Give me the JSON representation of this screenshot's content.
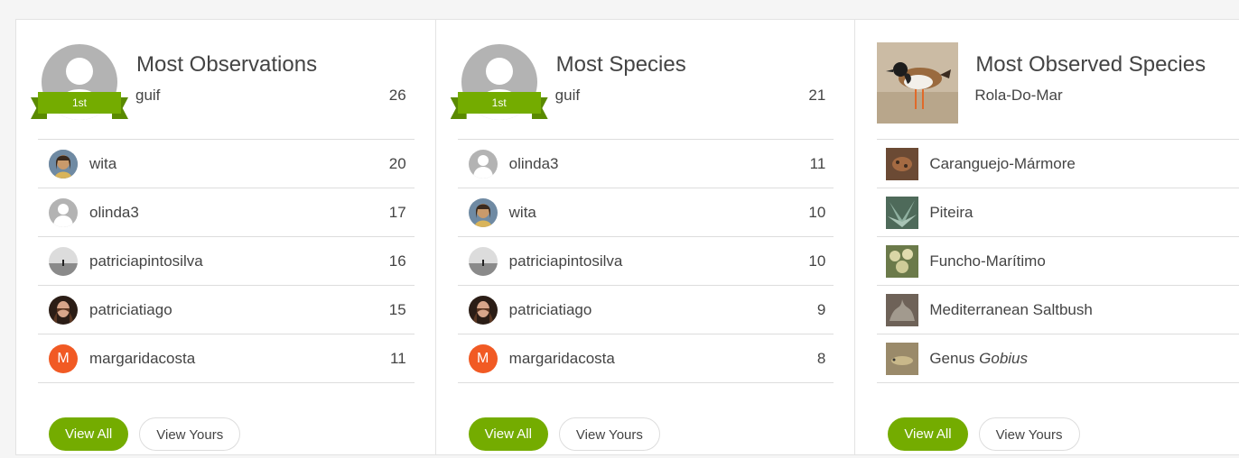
{
  "observers": {
    "title": "Most Observations",
    "rank_label": "1st",
    "leader": {
      "name": "guif",
      "count": "26"
    },
    "rows": [
      {
        "name": "wita",
        "count": "20"
      },
      {
        "name": "olinda3",
        "count": "17"
      },
      {
        "name": "patriciapintosilva",
        "count": "16"
      },
      {
        "name": "patriciatiago",
        "count": "15"
      },
      {
        "name": "margaridacosta",
        "count": "11",
        "initial": "M"
      }
    ],
    "view_all": "View All",
    "view_yours": "View Yours"
  },
  "species_observers": {
    "title": "Most Species",
    "rank_label": "1st",
    "leader": {
      "name": "guif",
      "count": "21"
    },
    "rows": [
      {
        "name": "olinda3",
        "count": "11"
      },
      {
        "name": "wita",
        "count": "10"
      },
      {
        "name": "patriciapintosilva",
        "count": "10"
      },
      {
        "name": "patriciatiago",
        "count": "9"
      },
      {
        "name": "margaridacosta",
        "count": "8",
        "initial": "M"
      }
    ],
    "view_all": "View All",
    "view_yours": "View Yours"
  },
  "species": {
    "title": "Most Observed Species",
    "leader": {
      "name": "Rola-Do-Mar"
    },
    "rows": [
      {
        "name": "Caranguejo-Mármore"
      },
      {
        "name": "Piteira"
      },
      {
        "name": "Funcho-Marítimo"
      },
      {
        "name": "Mediterranean Saltbush"
      },
      {
        "rank": "Genus",
        "name": "Gobius"
      }
    ],
    "view_all": "View All",
    "view_yours": "View Yours"
  },
  "colors": {
    "accent": "#74ac00",
    "monogram": "#f15a24",
    "placeholder": "#b3b3b3"
  }
}
